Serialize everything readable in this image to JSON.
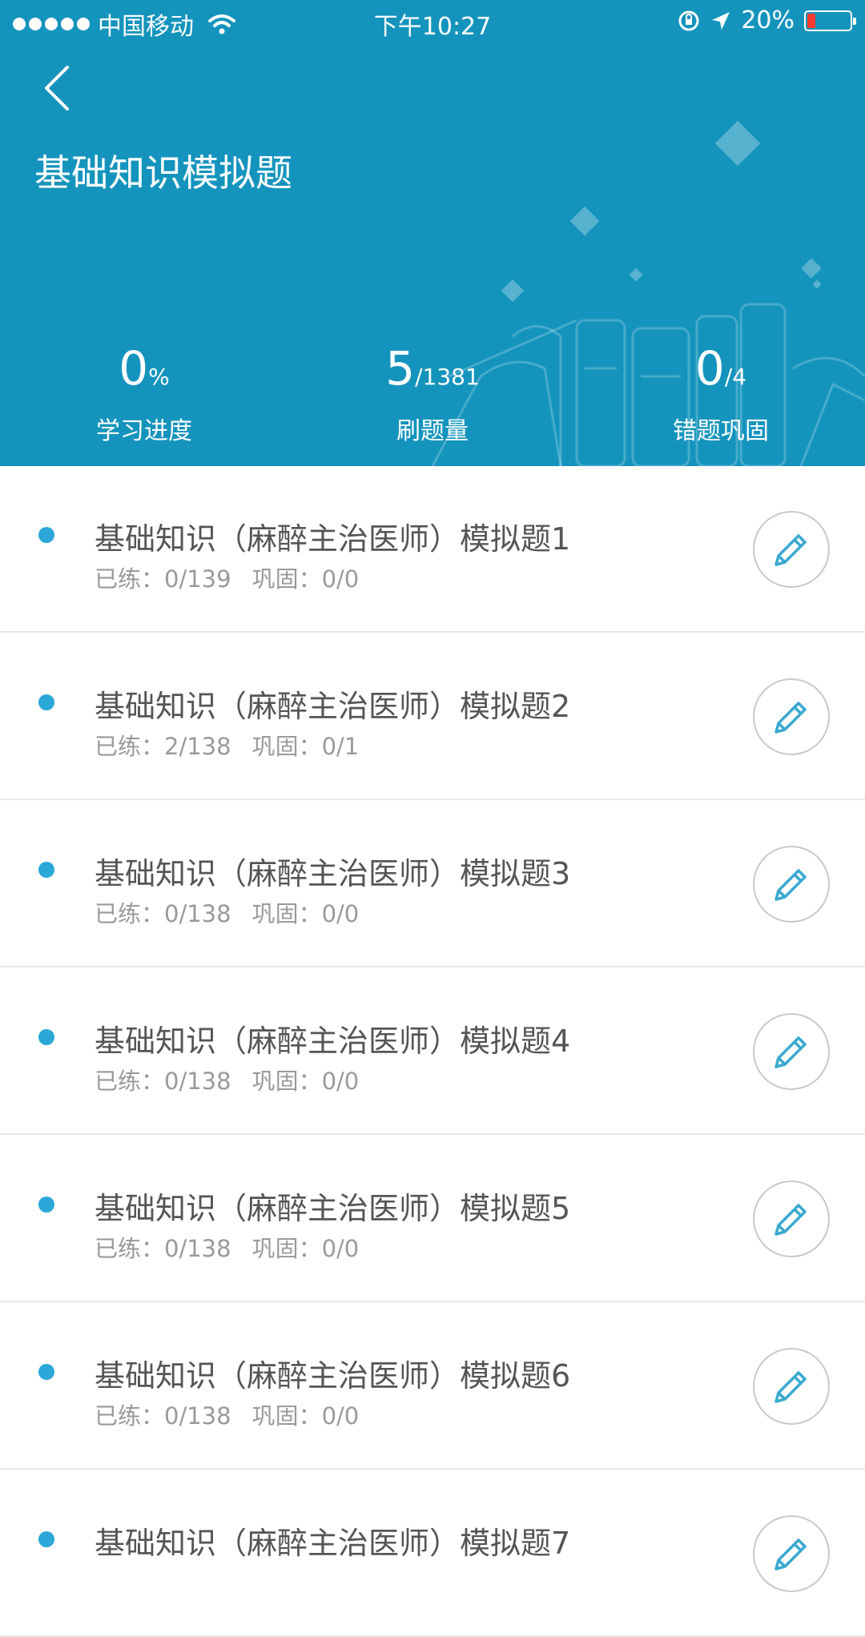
{
  "status_bar": {
    "carrier": "中国移动",
    "time": "下午10:27",
    "battery": "20%",
    "battery_level": 0.2,
    "battery_color": "#ff3b30"
  },
  "header": {
    "title": "基础知识模拟题",
    "background": "#1494bd"
  },
  "stats": [
    {
      "big": "0",
      "small": "%",
      "label": "学习进度"
    },
    {
      "big": "5",
      "small": "/1381",
      "label": "刷题量"
    },
    {
      "big": "0",
      "small": "/4",
      "label": "错题巩固"
    }
  ],
  "list": {
    "accent": "#2ba7d8",
    "items": [
      {
        "title": "基础知识（麻醉主治医师）模拟题1",
        "practiced": "已练：0/139",
        "consolidated": "巩固：0/0"
      },
      {
        "title": "基础知识（麻醉主治医师）模拟题2",
        "practiced": "已练：2/138",
        "consolidated": "巩固：0/1"
      },
      {
        "title": "基础知识（麻醉主治医师）模拟题3",
        "practiced": "已练：0/138",
        "consolidated": "巩固：0/0"
      },
      {
        "title": "基础知识（麻醉主治医师）模拟题4",
        "practiced": "已练：0/138",
        "consolidated": "巩固：0/0"
      },
      {
        "title": "基础知识（麻醉主治医师）模拟题5",
        "practiced": "已练：0/138",
        "consolidated": "巩固：0/0"
      },
      {
        "title": "基础知识（麻醉主治医师）模拟题6",
        "practiced": "已练：0/138",
        "consolidated": "巩固：0/0"
      },
      {
        "title": "基础知识（麻醉主治医师）模拟题7",
        "practiced": "",
        "consolidated": ""
      }
    ]
  }
}
